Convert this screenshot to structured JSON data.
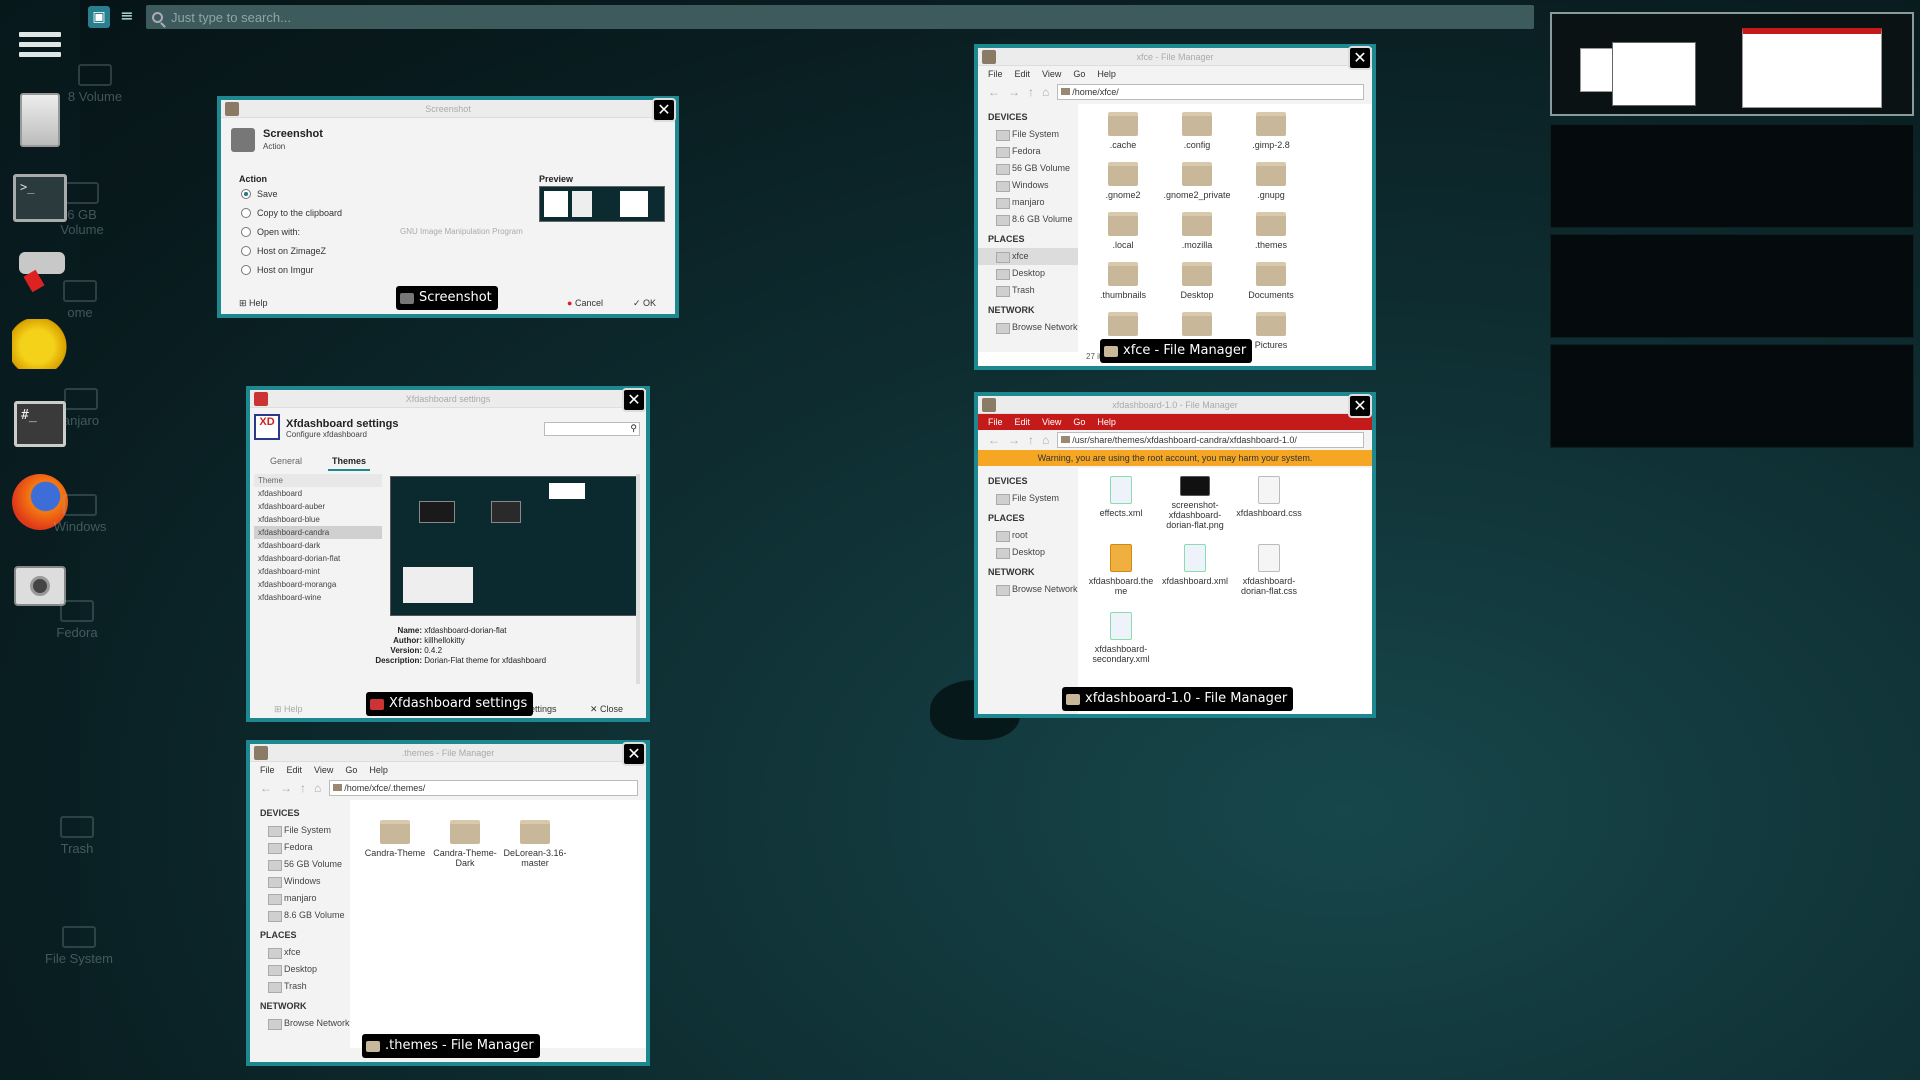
{
  "search": {
    "placeholder": "Just type to search..."
  },
  "dock": {
    "ghost_labels": [
      "8 Volume",
      "6 GB\nVolume",
      "ome",
      "anjaro",
      "Windows",
      "Fedora",
      "Trash",
      "File System"
    ]
  },
  "windows": {
    "screenshot": {
      "title": "Screenshot",
      "caption": "Screenshot",
      "header_title": "Screenshot",
      "header_sub": "Action",
      "action_label": "Action",
      "preview_label": "Preview",
      "options": [
        "Save",
        "Copy to the clipboard",
        "Open with:",
        "Host on ZimageZ",
        "Host on Imgur"
      ],
      "open_with_app": "GNU Image Manipulation Program",
      "help": "Help",
      "cancel": "Cancel",
      "ok": "OK"
    },
    "settings": {
      "title": "Xfdashboard settings",
      "caption": "Xfdashboard settings",
      "header_title": "Xfdashboard settings",
      "header_sub": "Configure xfdashboard",
      "tab_general": "General",
      "tab_themes": "Themes",
      "theme_header": "Theme",
      "themes": [
        "xfdashboard",
        "xfdashboard-auber",
        "xfdashboard-blue",
        "xfdashboard-candra",
        "xfdashboard-dark",
        "xfdashboard-dorian-flat",
        "xfdashboard-mint",
        "xfdashboard-moranga",
        "xfdashboard-wine"
      ],
      "selected_theme_index": 3,
      "info": {
        "name_label": "Name:",
        "name": "xfdashboard-dorian-flat",
        "author_label": "Author:",
        "author": "killhellokitty",
        "version_label": "Version:",
        "version": "0.4.2",
        "desc_label": "Description:",
        "desc": "Dorian-Flat theme for xfdashboard"
      },
      "help": "Help",
      "settings_fragment": "ettings",
      "close": "Close"
    },
    "themes_fm": {
      "title": ".themes - File Manager",
      "caption": ".themes - File Manager",
      "menu": [
        "File",
        "Edit",
        "View",
        "Go",
        "Help"
      ],
      "path": "/home/xfce/.themes/",
      "devices_header": "DEVICES",
      "devices": [
        "File System",
        "Fedora",
        "56 GB Volume",
        "Windows",
        "manjaro",
        "8.6 GB Volume"
      ],
      "places_header": "PLACES",
      "places": [
        "xfce",
        "Desktop",
        "Trash"
      ],
      "network_header": "NETWORK",
      "network": [
        "Browse Network"
      ],
      "files": [
        "Candra-Theme",
        "Candra-Theme-\nDark",
        "DeLorean-3.16-\nmaster"
      ]
    },
    "xfce_fm": {
      "title": "xfce - File Manager",
      "caption": "xfce - File Manager",
      "menu": [
        "File",
        "Edit",
        "View",
        "Go",
        "Help"
      ],
      "path": "/home/xfce/",
      "devices_header": "DEVICES",
      "devices": [
        "File System",
        "Fedora",
        "56 GB Volume",
        "Windows",
        "manjaro",
        "8.6 GB Volume"
      ],
      "places_header": "PLACES",
      "places": [
        "xfce",
        "Desktop",
        "Trash"
      ],
      "selected_place_index": 0,
      "network_header": "NETWORK",
      "network": [
        "Browse Network"
      ],
      "files": [
        ".cache",
        ".config",
        ".gimp-2.8",
        ".gnome2",
        ".gnome2_private",
        ".gnupg",
        ".local",
        ".mozilla",
        ".themes",
        ".thumbnails",
        "Desktop",
        "Documents",
        "",
        "",
        "Pictures"
      ],
      "status": "27 items"
    },
    "root_fm": {
      "title": "xfdashboard-1.0 - File Manager",
      "caption": "xfdashboard-1.0 - File Manager",
      "menu": [
        "File",
        "Edit",
        "View",
        "Go",
        "Help"
      ],
      "path": "/usr/share/themes/xfdashboard-candra/xfdashboard-1.0/",
      "warning": "Warning, you are using the root account, you may harm your system.",
      "devices_header": "DEVICES",
      "devices": [
        "File System"
      ],
      "places_header": "PLACES",
      "places": [
        "root",
        "Desktop"
      ],
      "network_header": "NETWORK",
      "network": [
        "Browse Network"
      ],
      "files": [
        "effects.xml",
        "screenshot-\nxfdashboard-\ndorian-flat.png",
        "xfdashboard.css",
        "xfdashboard.the\nme",
        "xfdashboard.xml",
        "xfdashboard-\ndorian-flat.css",
        "xfdashboard-\nsecondary.xml"
      ]
    }
  },
  "colors": {
    "accent": "#1e8890",
    "root_bar": "#c41a1a",
    "warning": "#f5a623"
  }
}
